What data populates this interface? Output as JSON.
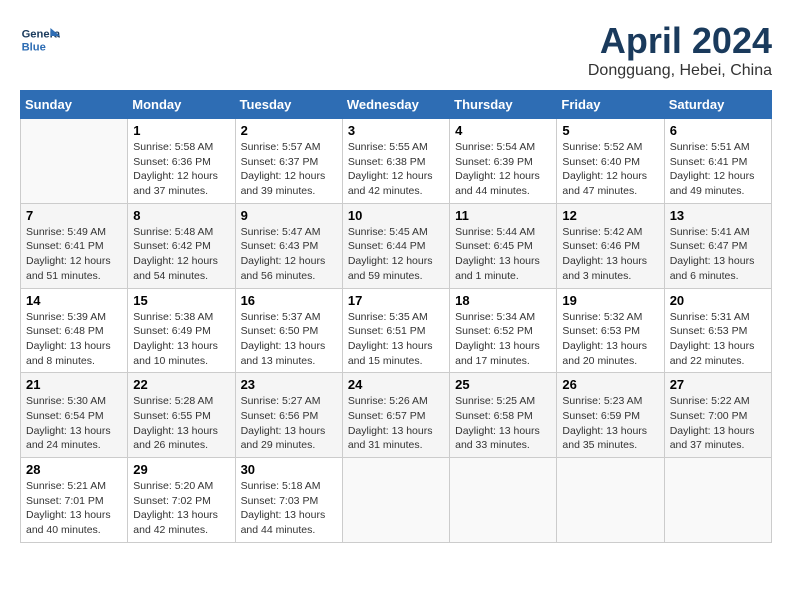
{
  "header": {
    "logo_general": "General",
    "logo_blue": "Blue",
    "title": "April 2024",
    "location": "Dongguang, Hebei, China"
  },
  "weekdays": [
    "Sunday",
    "Monday",
    "Tuesday",
    "Wednesday",
    "Thursday",
    "Friday",
    "Saturday"
  ],
  "weeks": [
    [
      {
        "day": "",
        "info": ""
      },
      {
        "day": "1",
        "info": "Sunrise: 5:58 AM\nSunset: 6:36 PM\nDaylight: 12 hours\nand 37 minutes."
      },
      {
        "day": "2",
        "info": "Sunrise: 5:57 AM\nSunset: 6:37 PM\nDaylight: 12 hours\nand 39 minutes."
      },
      {
        "day": "3",
        "info": "Sunrise: 5:55 AM\nSunset: 6:38 PM\nDaylight: 12 hours\nand 42 minutes."
      },
      {
        "day": "4",
        "info": "Sunrise: 5:54 AM\nSunset: 6:39 PM\nDaylight: 12 hours\nand 44 minutes."
      },
      {
        "day": "5",
        "info": "Sunrise: 5:52 AM\nSunset: 6:40 PM\nDaylight: 12 hours\nand 47 minutes."
      },
      {
        "day": "6",
        "info": "Sunrise: 5:51 AM\nSunset: 6:41 PM\nDaylight: 12 hours\nand 49 minutes."
      }
    ],
    [
      {
        "day": "7",
        "info": "Sunrise: 5:49 AM\nSunset: 6:41 PM\nDaylight: 12 hours\nand 51 minutes."
      },
      {
        "day": "8",
        "info": "Sunrise: 5:48 AM\nSunset: 6:42 PM\nDaylight: 12 hours\nand 54 minutes."
      },
      {
        "day": "9",
        "info": "Sunrise: 5:47 AM\nSunset: 6:43 PM\nDaylight: 12 hours\nand 56 minutes."
      },
      {
        "day": "10",
        "info": "Sunrise: 5:45 AM\nSunset: 6:44 PM\nDaylight: 12 hours\nand 59 minutes."
      },
      {
        "day": "11",
        "info": "Sunrise: 5:44 AM\nSunset: 6:45 PM\nDaylight: 13 hours\nand 1 minute."
      },
      {
        "day": "12",
        "info": "Sunrise: 5:42 AM\nSunset: 6:46 PM\nDaylight: 13 hours\nand 3 minutes."
      },
      {
        "day": "13",
        "info": "Sunrise: 5:41 AM\nSunset: 6:47 PM\nDaylight: 13 hours\nand 6 minutes."
      }
    ],
    [
      {
        "day": "14",
        "info": "Sunrise: 5:39 AM\nSunset: 6:48 PM\nDaylight: 13 hours\nand 8 minutes."
      },
      {
        "day": "15",
        "info": "Sunrise: 5:38 AM\nSunset: 6:49 PM\nDaylight: 13 hours\nand 10 minutes."
      },
      {
        "day": "16",
        "info": "Sunrise: 5:37 AM\nSunset: 6:50 PM\nDaylight: 13 hours\nand 13 minutes."
      },
      {
        "day": "17",
        "info": "Sunrise: 5:35 AM\nSunset: 6:51 PM\nDaylight: 13 hours\nand 15 minutes."
      },
      {
        "day": "18",
        "info": "Sunrise: 5:34 AM\nSunset: 6:52 PM\nDaylight: 13 hours\nand 17 minutes."
      },
      {
        "day": "19",
        "info": "Sunrise: 5:32 AM\nSunset: 6:53 PM\nDaylight: 13 hours\nand 20 minutes."
      },
      {
        "day": "20",
        "info": "Sunrise: 5:31 AM\nSunset: 6:53 PM\nDaylight: 13 hours\nand 22 minutes."
      }
    ],
    [
      {
        "day": "21",
        "info": "Sunrise: 5:30 AM\nSunset: 6:54 PM\nDaylight: 13 hours\nand 24 minutes."
      },
      {
        "day": "22",
        "info": "Sunrise: 5:28 AM\nSunset: 6:55 PM\nDaylight: 13 hours\nand 26 minutes."
      },
      {
        "day": "23",
        "info": "Sunrise: 5:27 AM\nSunset: 6:56 PM\nDaylight: 13 hours\nand 29 minutes."
      },
      {
        "day": "24",
        "info": "Sunrise: 5:26 AM\nSunset: 6:57 PM\nDaylight: 13 hours\nand 31 minutes."
      },
      {
        "day": "25",
        "info": "Sunrise: 5:25 AM\nSunset: 6:58 PM\nDaylight: 13 hours\nand 33 minutes."
      },
      {
        "day": "26",
        "info": "Sunrise: 5:23 AM\nSunset: 6:59 PM\nDaylight: 13 hours\nand 35 minutes."
      },
      {
        "day": "27",
        "info": "Sunrise: 5:22 AM\nSunset: 7:00 PM\nDaylight: 13 hours\nand 37 minutes."
      }
    ],
    [
      {
        "day": "28",
        "info": "Sunrise: 5:21 AM\nSunset: 7:01 PM\nDaylight: 13 hours\nand 40 minutes."
      },
      {
        "day": "29",
        "info": "Sunrise: 5:20 AM\nSunset: 7:02 PM\nDaylight: 13 hours\nand 42 minutes."
      },
      {
        "day": "30",
        "info": "Sunrise: 5:18 AM\nSunset: 7:03 PM\nDaylight: 13 hours\nand 44 minutes."
      },
      {
        "day": "",
        "info": ""
      },
      {
        "day": "",
        "info": ""
      },
      {
        "day": "",
        "info": ""
      },
      {
        "day": "",
        "info": ""
      }
    ]
  ]
}
